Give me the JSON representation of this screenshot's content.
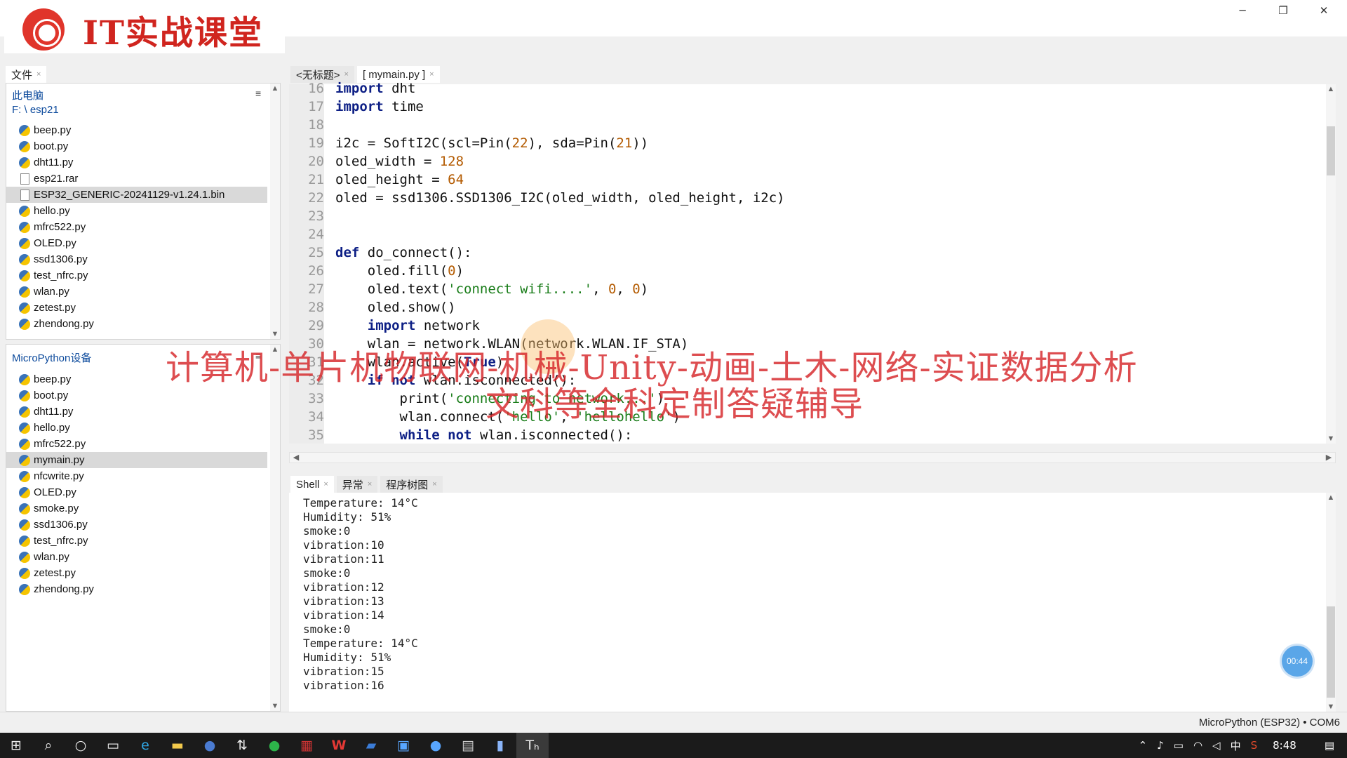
{
  "logo": {
    "text": "IT实战课堂"
  },
  "window": {
    "minimize": "─",
    "restore": "❐",
    "close": "✕"
  },
  "files_tab": {
    "label": "文件",
    "close": "×"
  },
  "local": {
    "title": "此电脑",
    "path": "F: \\ esp21",
    "menu": "≡",
    "files": [
      {
        "name": "beep.py",
        "type": "py",
        "selected": false
      },
      {
        "name": "boot.py",
        "type": "py",
        "selected": false
      },
      {
        "name": "dht11.py",
        "type": "py",
        "selected": false
      },
      {
        "name": "esp21.rar",
        "type": "file",
        "selected": false
      },
      {
        "name": "ESP32_GENERIC-20241129-v1.24.1.bin",
        "type": "file",
        "selected": true
      },
      {
        "name": "hello.py",
        "type": "py",
        "selected": false
      },
      {
        "name": "mfrc522.py",
        "type": "py",
        "selected": false
      },
      {
        "name": "OLED.py",
        "type": "py",
        "selected": false
      },
      {
        "name": "ssd1306.py",
        "type": "py",
        "selected": false
      },
      {
        "name": "test_nfrc.py",
        "type": "py",
        "selected": false
      },
      {
        "name": "wlan.py",
        "type": "py",
        "selected": false
      },
      {
        "name": "zetest.py",
        "type": "py",
        "selected": false
      },
      {
        "name": "zhendong.py",
        "type": "py",
        "selected": false
      }
    ]
  },
  "device": {
    "title": "MicroPython设备",
    "menu": "≡",
    "files": [
      {
        "name": "beep.py",
        "type": "py",
        "selected": false
      },
      {
        "name": "boot.py",
        "type": "py",
        "selected": false
      },
      {
        "name": "dht11.py",
        "type": "py",
        "selected": false
      },
      {
        "name": "hello.py",
        "type": "py",
        "selected": false
      },
      {
        "name": "mfrc522.py",
        "type": "py",
        "selected": false
      },
      {
        "name": "mymain.py",
        "type": "py",
        "selected": true
      },
      {
        "name": "nfcwrite.py",
        "type": "py",
        "selected": false
      },
      {
        "name": "OLED.py",
        "type": "py",
        "selected": false
      },
      {
        "name": "smoke.py",
        "type": "py",
        "selected": false
      },
      {
        "name": "ssd1306.py",
        "type": "py",
        "selected": false
      },
      {
        "name": "test_nfrc.py",
        "type": "py",
        "selected": false
      },
      {
        "name": "wlan.py",
        "type": "py",
        "selected": false
      },
      {
        "name": "zetest.py",
        "type": "py",
        "selected": false
      },
      {
        "name": "zhendong.py",
        "type": "py",
        "selected": false
      }
    ]
  },
  "editor_tabs": [
    {
      "label": "<无标题>",
      "close": "×"
    },
    {
      "label": "[ mymain.py ]",
      "close": "×"
    }
  ],
  "code": [
    {
      "n": "16",
      "segs": [
        {
          "t": "import",
          "c": "kw"
        },
        {
          "t": " dht",
          "c": ""
        }
      ]
    },
    {
      "n": "17",
      "segs": [
        {
          "t": "import",
          "c": "kw"
        },
        {
          "t": " time",
          "c": ""
        }
      ]
    },
    {
      "n": "18",
      "segs": []
    },
    {
      "n": "19",
      "segs": [
        {
          "t": "i2c = SoftI2C(scl=Pin(",
          "c": ""
        },
        {
          "t": "22",
          "c": "num"
        },
        {
          "t": "), sda=Pin(",
          "c": ""
        },
        {
          "t": "21",
          "c": "num"
        },
        {
          "t": "))",
          "c": ""
        }
      ]
    },
    {
      "n": "20",
      "segs": [
        {
          "t": "oled_width = ",
          "c": ""
        },
        {
          "t": "128",
          "c": "num"
        }
      ]
    },
    {
      "n": "21",
      "segs": [
        {
          "t": "oled_height = ",
          "c": ""
        },
        {
          "t": "64",
          "c": "num"
        }
      ]
    },
    {
      "n": "22",
      "segs": [
        {
          "t": "oled = ssd1306.SSD1306_I2C(oled_width, oled_height, i2c)",
          "c": ""
        }
      ]
    },
    {
      "n": "23",
      "segs": []
    },
    {
      "n": "24",
      "segs": []
    },
    {
      "n": "25",
      "segs": [
        {
          "t": "def",
          "c": "kw"
        },
        {
          "t": " do_connect():",
          "c": ""
        }
      ]
    },
    {
      "n": "26",
      "segs": [
        {
          "t": "    oled.fill(",
          "c": ""
        },
        {
          "t": "0",
          "c": "num"
        },
        {
          "t": ")",
          "c": ""
        }
      ]
    },
    {
      "n": "27",
      "segs": [
        {
          "t": "    oled.text(",
          "c": ""
        },
        {
          "t": "'connect wifi....'",
          "c": "str"
        },
        {
          "t": ", ",
          "c": ""
        },
        {
          "t": "0",
          "c": "num"
        },
        {
          "t": ", ",
          "c": ""
        },
        {
          "t": "0",
          "c": "num"
        },
        {
          "t": ")",
          "c": ""
        }
      ]
    },
    {
      "n": "28",
      "segs": [
        {
          "t": "    oled.show()",
          "c": ""
        }
      ]
    },
    {
      "n": "29",
      "segs": [
        {
          "t": "    ",
          "c": ""
        },
        {
          "t": "import",
          "c": "kw"
        },
        {
          "t": " network",
          "c": ""
        }
      ]
    },
    {
      "n": "30",
      "segs": [
        {
          "t": "    wlan = network.WLAN(network.WLAN.IF_STA)",
          "c": ""
        }
      ]
    },
    {
      "n": "31",
      "segs": [
        {
          "t": "    wlan.active(",
          "c": ""
        },
        {
          "t": "True",
          "c": "kw"
        },
        {
          "t": ")",
          "c": ""
        }
      ]
    },
    {
      "n": "32",
      "segs": [
        {
          "t": "    ",
          "c": ""
        },
        {
          "t": "if",
          "c": "kw"
        },
        {
          "t": " ",
          "c": ""
        },
        {
          "t": "not",
          "c": "kw"
        },
        {
          "t": " wlan.isconnected():",
          "c": ""
        }
      ]
    },
    {
      "n": "33",
      "segs": [
        {
          "t": "        print(",
          "c": ""
        },
        {
          "t": "'connecting to network...'",
          "c": "str"
        },
        {
          "t": ")",
          "c": ""
        }
      ]
    },
    {
      "n": "34",
      "segs": [
        {
          "t": "        wlan.connect(",
          "c": ""
        },
        {
          "t": "'hello'",
          "c": "str"
        },
        {
          "t": ", ",
          "c": ""
        },
        {
          "t": "'hellohello'",
          "c": "str"
        },
        {
          "t": ")",
          "c": ""
        }
      ]
    },
    {
      "n": "35",
      "segs": [
        {
          "t": "        ",
          "c": ""
        },
        {
          "t": "while",
          "c": "kw"
        },
        {
          "t": " ",
          "c": ""
        },
        {
          "t": "not",
          "c": "kw"
        },
        {
          "t": " wlan.isconnected():",
          "c": ""
        }
      ]
    }
  ],
  "shell_tabs": [
    {
      "label": "Shell",
      "close": "×"
    },
    {
      "label": "异常",
      "close": "×"
    },
    {
      "label": "程序树图",
      "close": "×"
    }
  ],
  "shell_lines": [
    "Temperature: 14°C",
    "Humidity: 51%",
    "smoke:0",
    "vibration:10",
    "vibration:11",
    "smoke:0",
    "vibration:12",
    "vibration:13",
    "vibration:14",
    "smoke:0",
    "Temperature: 14°C",
    "Humidity: 51%",
    "vibration:15",
    "vibration:16"
  ],
  "watermark": {
    "line1": "计算机-单片机物联网-机械-Unity-动画-土木-网络-实证数据分析",
    "line2": "文科等全科定制答疑辅导"
  },
  "timer": "00:44",
  "status": "MicroPython (ESP32) • COM6",
  "taskbar": {
    "apps": [
      "start-icon",
      "search-icon",
      "cortana-icon",
      "task-view-icon",
      "edge-icon",
      "explorer-icon",
      "app-icon",
      "app-icon",
      "app-icon",
      "app-icon",
      "wps-icon",
      "app-icon",
      "app-icon",
      "app-icon",
      "app-icon",
      "app-icon",
      "thonny-icon"
    ],
    "tray": {
      "ime": "中",
      "time": "8:48"
    }
  }
}
